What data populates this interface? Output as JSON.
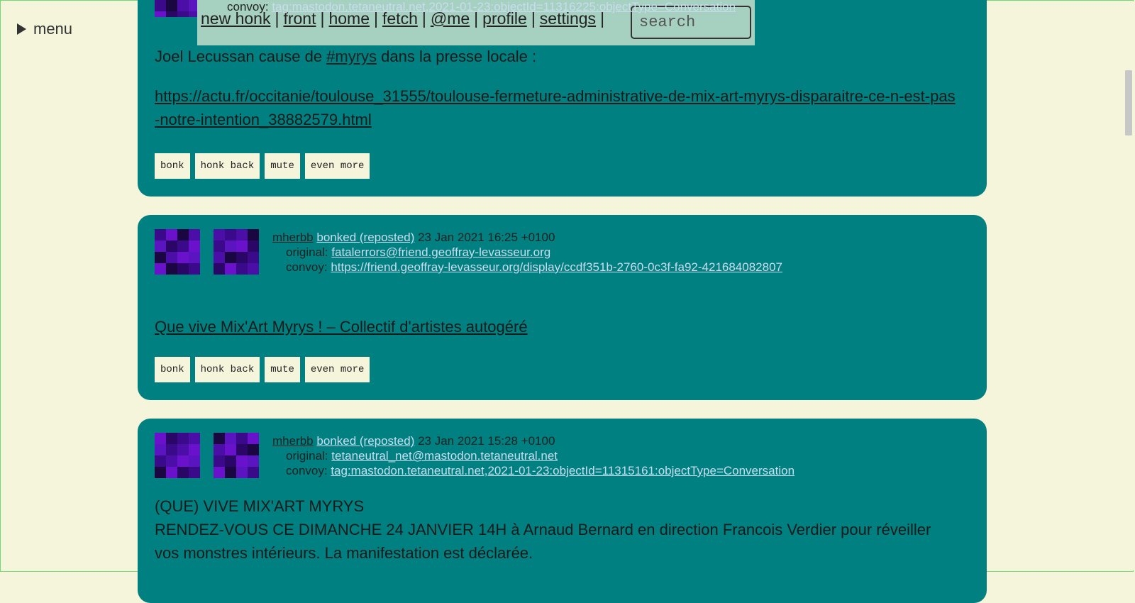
{
  "menu": {
    "label": "menu"
  },
  "nav": {
    "links": [
      "new honk",
      "front",
      "home",
      "fetch",
      "@me",
      "profile",
      "settings"
    ],
    "separator": "|",
    "search_placeholder": "search"
  },
  "top_card": {
    "convoy_label": "convoy:",
    "convoy_link": "tag:mastodon.tetaneutral.net,2021-01-23:objectId=11316225:objectType=Conversation",
    "text_prefix": "Joel Lecussan cause de ",
    "hashtag": "#myrys",
    "text_suffix": " dans la presse locale :",
    "url": "https://actu.fr/occitanie/toulouse_31555/toulouse-fermeture-administrative-de-mix-art-myrys-disparaitre-ce-n-est-pas-notre-intention_38882579.html"
  },
  "buttons": [
    "bonk",
    "honk back",
    "mute",
    "even more"
  ],
  "posts": [
    {
      "user": "mherbb",
      "action": "bonked (reposted)",
      "date": "23 Jan 2021 16:25 +0100",
      "original_label": "original:",
      "original": "fatalerrors@friend.geoffray-levasseur.org",
      "convoy_label": "convoy:",
      "convoy": "https://friend.geoffray-levasseur.org/display/ccdf351b-2760-0c3f-fa92-421684082807",
      "link_text": "Que vive Mix'Art Myrys ! – Collectif d'artistes autogéré"
    },
    {
      "user": "mherbb",
      "action": "bonked (reposted)",
      "date": "23 Jan 2021 15:28 +0100",
      "original_label": "original:",
      "original": "tetaneutral_net@mastodon.tetaneutral.net",
      "convoy_label": "convoy:",
      "convoy": "tag:mastodon.tetaneutral.net,2021-01-23:objectId=11315161:objectType=Conversation",
      "text_line1": "(QUE) VIVE MIX'ART MYRYS",
      "text_line2": "RENDEZ-VOUS CE DIMANCHE 24 JANVIER 14H à Arnaud Bernard en direction Francois Verdier pour réveiller vos monstres intérieurs. La manifestation est déclarée."
    }
  ],
  "colors": {
    "card": "#008080",
    "background": "#f5f5dc",
    "nav": "#a6d0c0",
    "avatar_dark": "#1a0640",
    "avatar_purple": "#6a11cb"
  }
}
